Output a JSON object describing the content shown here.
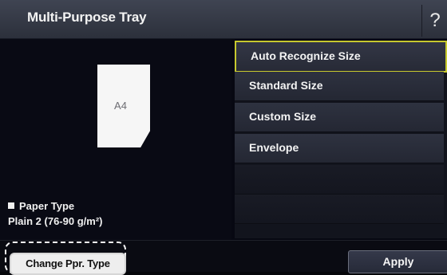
{
  "header": {
    "title": "Multi-Purpose Tray",
    "help_label": "?"
  },
  "preview": {
    "paper_size": "A4"
  },
  "paper_type": {
    "heading": "Paper Type",
    "value": "Plain 2 (76-90 g/m²)"
  },
  "size_menu": {
    "items": [
      {
        "label": "Auto Recognize Size",
        "selected": true
      },
      {
        "label": "Standard Size",
        "selected": false
      },
      {
        "label": "Custom Size",
        "selected": false
      },
      {
        "label": "Envelope",
        "selected": false
      }
    ]
  },
  "footer": {
    "change_type_label": "Change Ppr. Type",
    "apply_label": "Apply"
  },
  "colors": {
    "selection_border": "#c7c92e"
  }
}
